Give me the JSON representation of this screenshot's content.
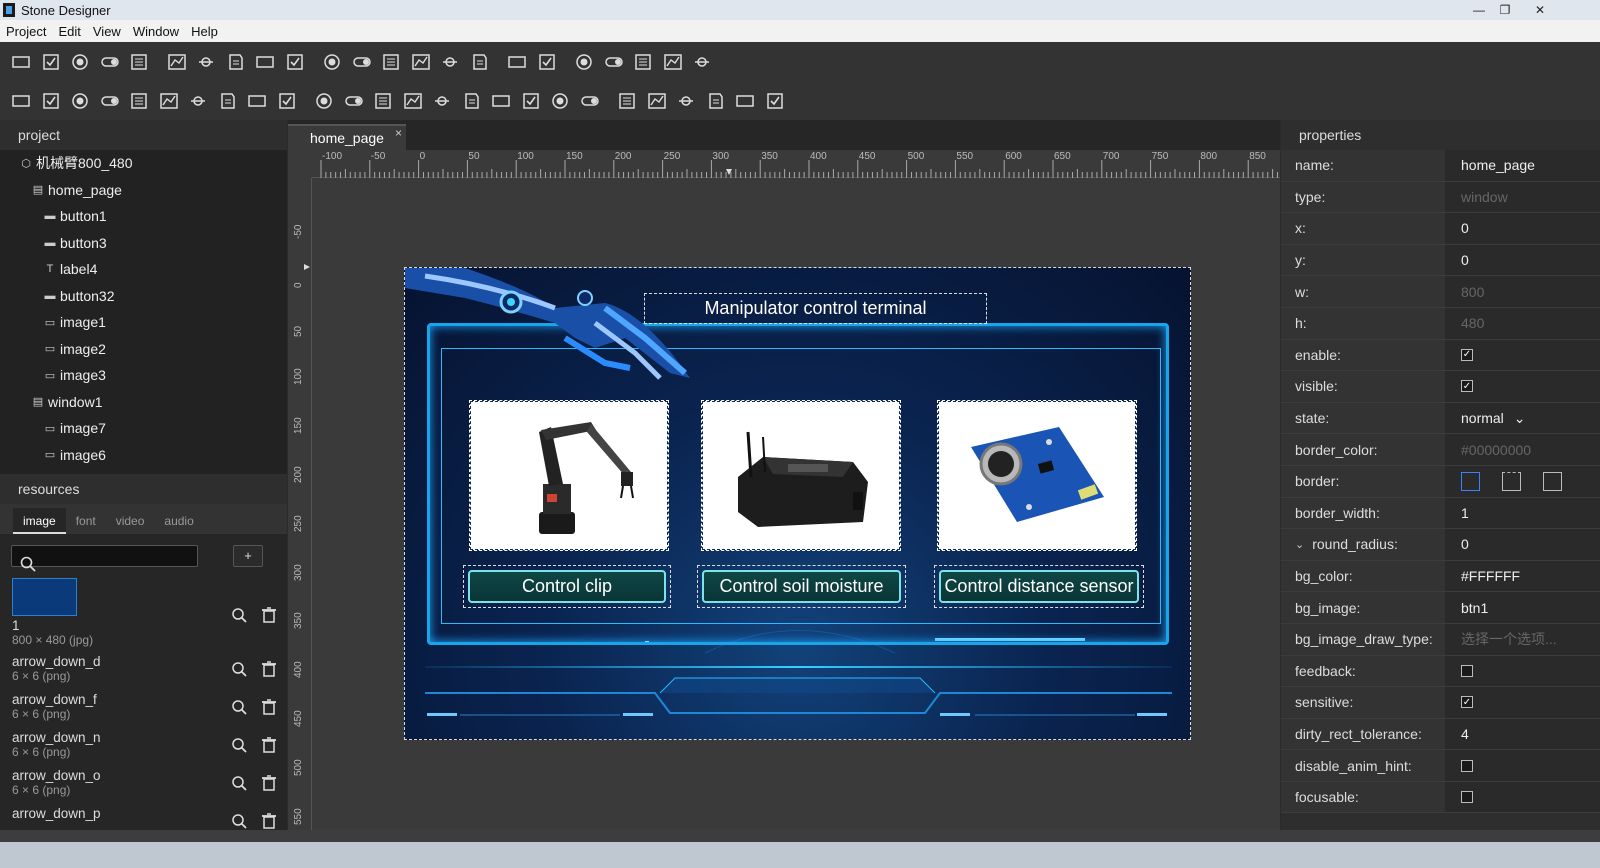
{
  "window": {
    "title": "Stone Designer"
  },
  "menu": [
    "Project",
    "Edit",
    "View",
    "Window",
    "Help"
  ],
  "toolbar1": [
    "btn-icon",
    "check-icon",
    "radio-icon",
    "toggle-icon",
    "list-icon",
    "chart-icon",
    "gif-icon",
    "svg-icon",
    "image-icon",
    "slide-icon",
    "edit-icon",
    "edit2-icon",
    "edit3-icon",
    "text-icon",
    "text2-icon",
    "label-icon",
    "sliders-icon",
    "progress-icon",
    "qr-icon",
    "mixer-icon",
    "download-icon",
    "lock-icon",
    "unlock-icon"
  ],
  "toolbar2": [
    "bar-icon",
    "tab-icon",
    "tab2-icon",
    "list2-icon",
    "list3-icon",
    "list4-icon",
    "monitor-icon",
    "monitor2-icon",
    "scroll-icon",
    "scroll2-icon",
    "clock-icon",
    "digit-icon",
    "gauge-icon",
    "thermo-icon",
    "grid1-icon",
    "grid2-icon",
    "grid3-icon",
    "grid4-icon",
    "grid5-icon",
    "grid6-icon",
    "table-icon",
    "table2-icon",
    "crop-icon",
    "move-icon",
    "barcode-icon",
    "qrcode-icon"
  ],
  "project": {
    "title": "project",
    "items": [
      {
        "label": "机械臂800_480",
        "icon": "cube-icon",
        "indent": 0
      },
      {
        "label": "home_page",
        "icon": "page-icon",
        "indent": 1
      },
      {
        "label": "button1",
        "icon": "button-icon",
        "indent": 2
      },
      {
        "label": "button3",
        "icon": "button-icon",
        "indent": 2
      },
      {
        "label": "label4",
        "icon": "text-icon",
        "indent": 2
      },
      {
        "label": "button32",
        "icon": "button-icon",
        "indent": 2
      },
      {
        "label": "image1",
        "icon": "image-icon",
        "indent": 2
      },
      {
        "label": "image2",
        "icon": "image-icon",
        "indent": 2
      },
      {
        "label": "image3",
        "icon": "image-icon",
        "indent": 2
      },
      {
        "label": "window1",
        "icon": "page-icon",
        "indent": 1
      },
      {
        "label": "image7",
        "icon": "image-icon",
        "indent": 2
      },
      {
        "label": "image6",
        "icon": "image-icon",
        "indent": 2
      }
    ]
  },
  "resources": {
    "title": "resources",
    "tabs": [
      "image",
      "font",
      "video",
      "audio"
    ],
    "active_tab": "image",
    "search_placeholder": "",
    "add_label": "+",
    "items": [
      {
        "name": "1",
        "meta": "800 × 480 (jpg)",
        "thumb": true
      },
      {
        "name": "arrow_down_d",
        "meta": "6 × 6 (png)"
      },
      {
        "name": "arrow_down_f",
        "meta": "6 × 6 (png)"
      },
      {
        "name": "arrow_down_n",
        "meta": "6 × 6 (png)"
      },
      {
        "name": "arrow_down_o",
        "meta": "6 × 6 (png)"
      },
      {
        "name": "arrow_down_p",
        "meta": ""
      }
    ]
  },
  "editor": {
    "tab": "home_page",
    "close": "×",
    "ruler_h": [
      "-100",
      "-50",
      "0",
      "50",
      "100",
      "150",
      "200",
      "250",
      "300",
      "350",
      "400",
      "450",
      "500",
      "550",
      "600",
      "650",
      "700",
      "750",
      "800",
      "850"
    ],
    "ruler_v": [
      "-50",
      "0",
      "50",
      "100",
      "150",
      "200",
      "250",
      "300",
      "350",
      "400",
      "450",
      "500",
      "550"
    ],
    "page": {
      "title": "Manipulator control terminal",
      "buttons": [
        "Control clip",
        "Control soil moisture",
        "Control distance sensor"
      ]
    }
  },
  "properties": {
    "title": "properties",
    "rows": [
      {
        "key": "name:",
        "value": "home_page",
        "kind": "text"
      },
      {
        "key": "type:",
        "value": "window",
        "kind": "dim"
      },
      {
        "key": "x:",
        "value": "0",
        "kind": "text"
      },
      {
        "key": "y:",
        "value": "0",
        "kind": "text"
      },
      {
        "key": "w:",
        "value": "800",
        "kind": "dim"
      },
      {
        "key": "h:",
        "value": "480",
        "kind": "dim"
      },
      {
        "key": "enable:",
        "value": "✓",
        "kind": "check"
      },
      {
        "key": "visible:",
        "value": "✓",
        "kind": "check"
      },
      {
        "key": "state:",
        "value": "normal",
        "kind": "select"
      },
      {
        "key": "border_color:",
        "value": "#00000000",
        "kind": "dim"
      },
      {
        "key": "border:",
        "value": "",
        "kind": "border"
      },
      {
        "key": "border_width:",
        "value": "1",
        "kind": "text"
      },
      {
        "key": "round_radius:",
        "value": "0",
        "kind": "text"
      },
      {
        "key": "bg_color:",
        "value": "#FFFFFF",
        "kind": "text"
      },
      {
        "key": "bg_image:",
        "value": "btn1",
        "kind": "text"
      },
      {
        "key": "bg_image_draw_type:",
        "value": "选择一个选项...",
        "kind": "dim"
      },
      {
        "key": "feedback:",
        "value": "",
        "kind": "check"
      },
      {
        "key": "sensitive:",
        "value": "✓",
        "kind": "check"
      },
      {
        "key": "dirty_rect_tolerance:",
        "value": "4",
        "kind": "text"
      },
      {
        "key": "disable_anim_hint:",
        "value": "",
        "kind": "check"
      },
      {
        "key": "focusable:",
        "value": "",
        "kind": "check"
      }
    ]
  },
  "colors": {
    "accent": "#19a6e8",
    "panel": "#262626",
    "canvas": "#3a3a3a"
  }
}
